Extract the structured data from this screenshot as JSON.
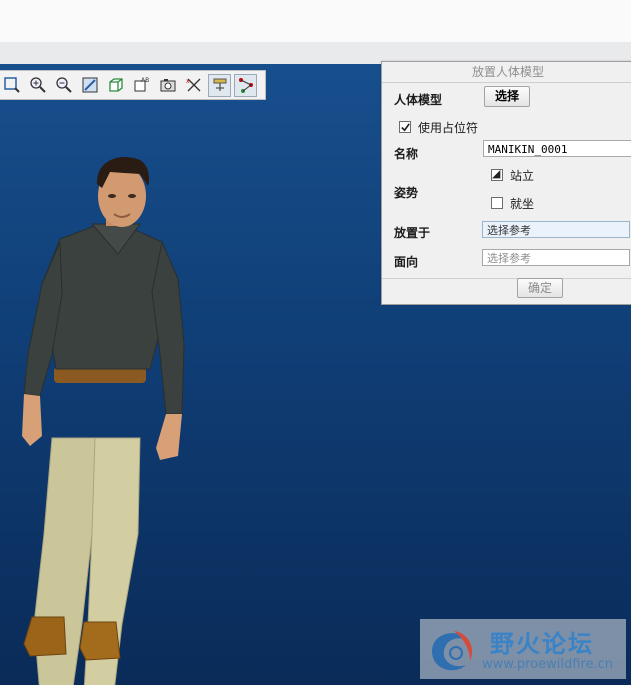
{
  "dialog": {
    "title": "放置人体模型",
    "model_label": "人体模型",
    "select_button": "选择",
    "use_placeholder_label": "使用占位符",
    "name_label": "名称",
    "name_value": "MANIKIN_0001",
    "posture_label": "姿势",
    "posture_options": [
      "站立",
      "就坐"
    ],
    "place_on_label": "放置于",
    "place_on_placeholder": "选择参考",
    "facing_label": "面向",
    "facing_placeholder": "选择参考",
    "ok_button": "确定"
  },
  "watermark": {
    "title": "野火论坛",
    "url": "www.proewildfire.cn"
  },
  "colors": {
    "viewport_top": "#174f8d",
    "viewport_bottom": "#0a2b58",
    "shirt": "#3b413f",
    "pants": "#cbc69a",
    "shoes": "#9b6419",
    "belt": "#8a5a22"
  },
  "toolbar_icons": [
    "zoom-fit-icon",
    "zoom-in-icon",
    "zoom-out-icon",
    "repaint-icon",
    "display-style-icon",
    "saved-views-icon",
    "camera-icon",
    "datum-display-icon",
    "spin-center-icon",
    "manikin-icon"
  ]
}
